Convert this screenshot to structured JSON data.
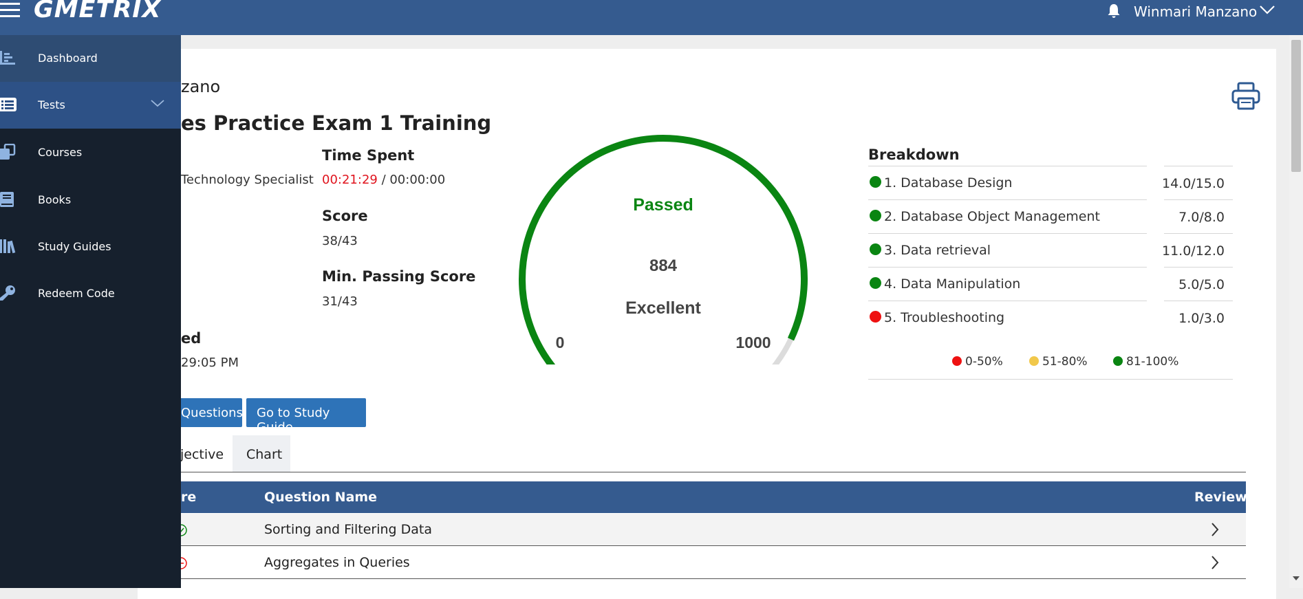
{
  "header": {
    "logo": "GMETRIX",
    "username": "Winmari Manzano",
    "icons": [
      "hamburger-icon",
      "bell-icon",
      "chevron-down-icon"
    ],
    "bg_color": "#355b8f"
  },
  "sidebar": {
    "items": [
      {
        "label": "Dashboard",
        "icon": "dashboard-icon"
      },
      {
        "label": "Tests",
        "icon": "list-icon",
        "expanded_indicator": "chevron-down-icon"
      },
      {
        "label": "Courses",
        "icon": "courses-icon"
      },
      {
        "label": "Books",
        "icon": "book-icon"
      },
      {
        "label": "Study Guides",
        "icon": "library-icon"
      },
      {
        "label": "Redeem Code",
        "icon": "key-icon"
      }
    ],
    "bg_color": "#16202d",
    "active_color": "#2d5186"
  },
  "main": {
    "partial_name": "zano",
    "exam_title": "es Practice Exam 1 Training",
    "print_icon": "printer-icon",
    "certification_partial": "Technology Specialist",
    "time_spent": {
      "label": "Time Spent",
      "elapsed": "00:21:29",
      "separator": " / ",
      "limit": "00:00:00"
    },
    "score": {
      "label": "Score",
      "value": "38/43"
    },
    "min_passing": {
      "label": "Min. Passing Score",
      "value": "31/43"
    },
    "completed": {
      "label_partial": "ed",
      "value_partial": "29:05 PM"
    },
    "gauge": {
      "status": "Passed",
      "value_text": "884",
      "value": 884,
      "max": 1000,
      "min_label": "0",
      "max_label": "1000",
      "rating": "Excellent",
      "fill_color": "#0a8512",
      "track_color": "#dcdcdc"
    },
    "breakdown": {
      "title": "Breakdown",
      "rows": [
        {
          "name": "1. Database Design",
          "score": "14.0/15.0",
          "color": "#0a8512"
        },
        {
          "name": "2. Database Object Management",
          "score": "7.0/8.0",
          "color": "#0a8512"
        },
        {
          "name": "3. Data retrieval",
          "score": "11.0/12.0",
          "color": "#0a8512"
        },
        {
          "name": "4. Data Manipulation",
          "score": "5.0/5.0",
          "color": "#0a8512"
        },
        {
          "name": "5. Troubleshooting",
          "score": "1.0/3.0",
          "color": "#ee1111"
        }
      ],
      "legend": [
        {
          "label": "0-50%",
          "color": "#ee1111"
        },
        {
          "label": "51-80%",
          "color": "#f1c84b"
        },
        {
          "label": "81-100%",
          "color": "#0a8512"
        }
      ]
    },
    "buttons": {
      "questions_partial": "Questions",
      "study_guide": "Go to Study Guide"
    },
    "tabs": [
      {
        "label": "jective"
      },
      {
        "label": "Chart"
      }
    ],
    "table": {
      "columns": {
        "score_partial": "re",
        "question_name": "Question Name",
        "review": "Review"
      },
      "rows": [
        {
          "question": "Sorting and Filtering Data",
          "status": "correct",
          "status_icon": "check-circle-icon",
          "review_icon": "chevron-right-icon"
        },
        {
          "question": "Aggregates in Queries",
          "status": "incorrect",
          "status_icon": "x-circle-icon",
          "review_icon": "chevron-right-icon"
        }
      ]
    }
  }
}
